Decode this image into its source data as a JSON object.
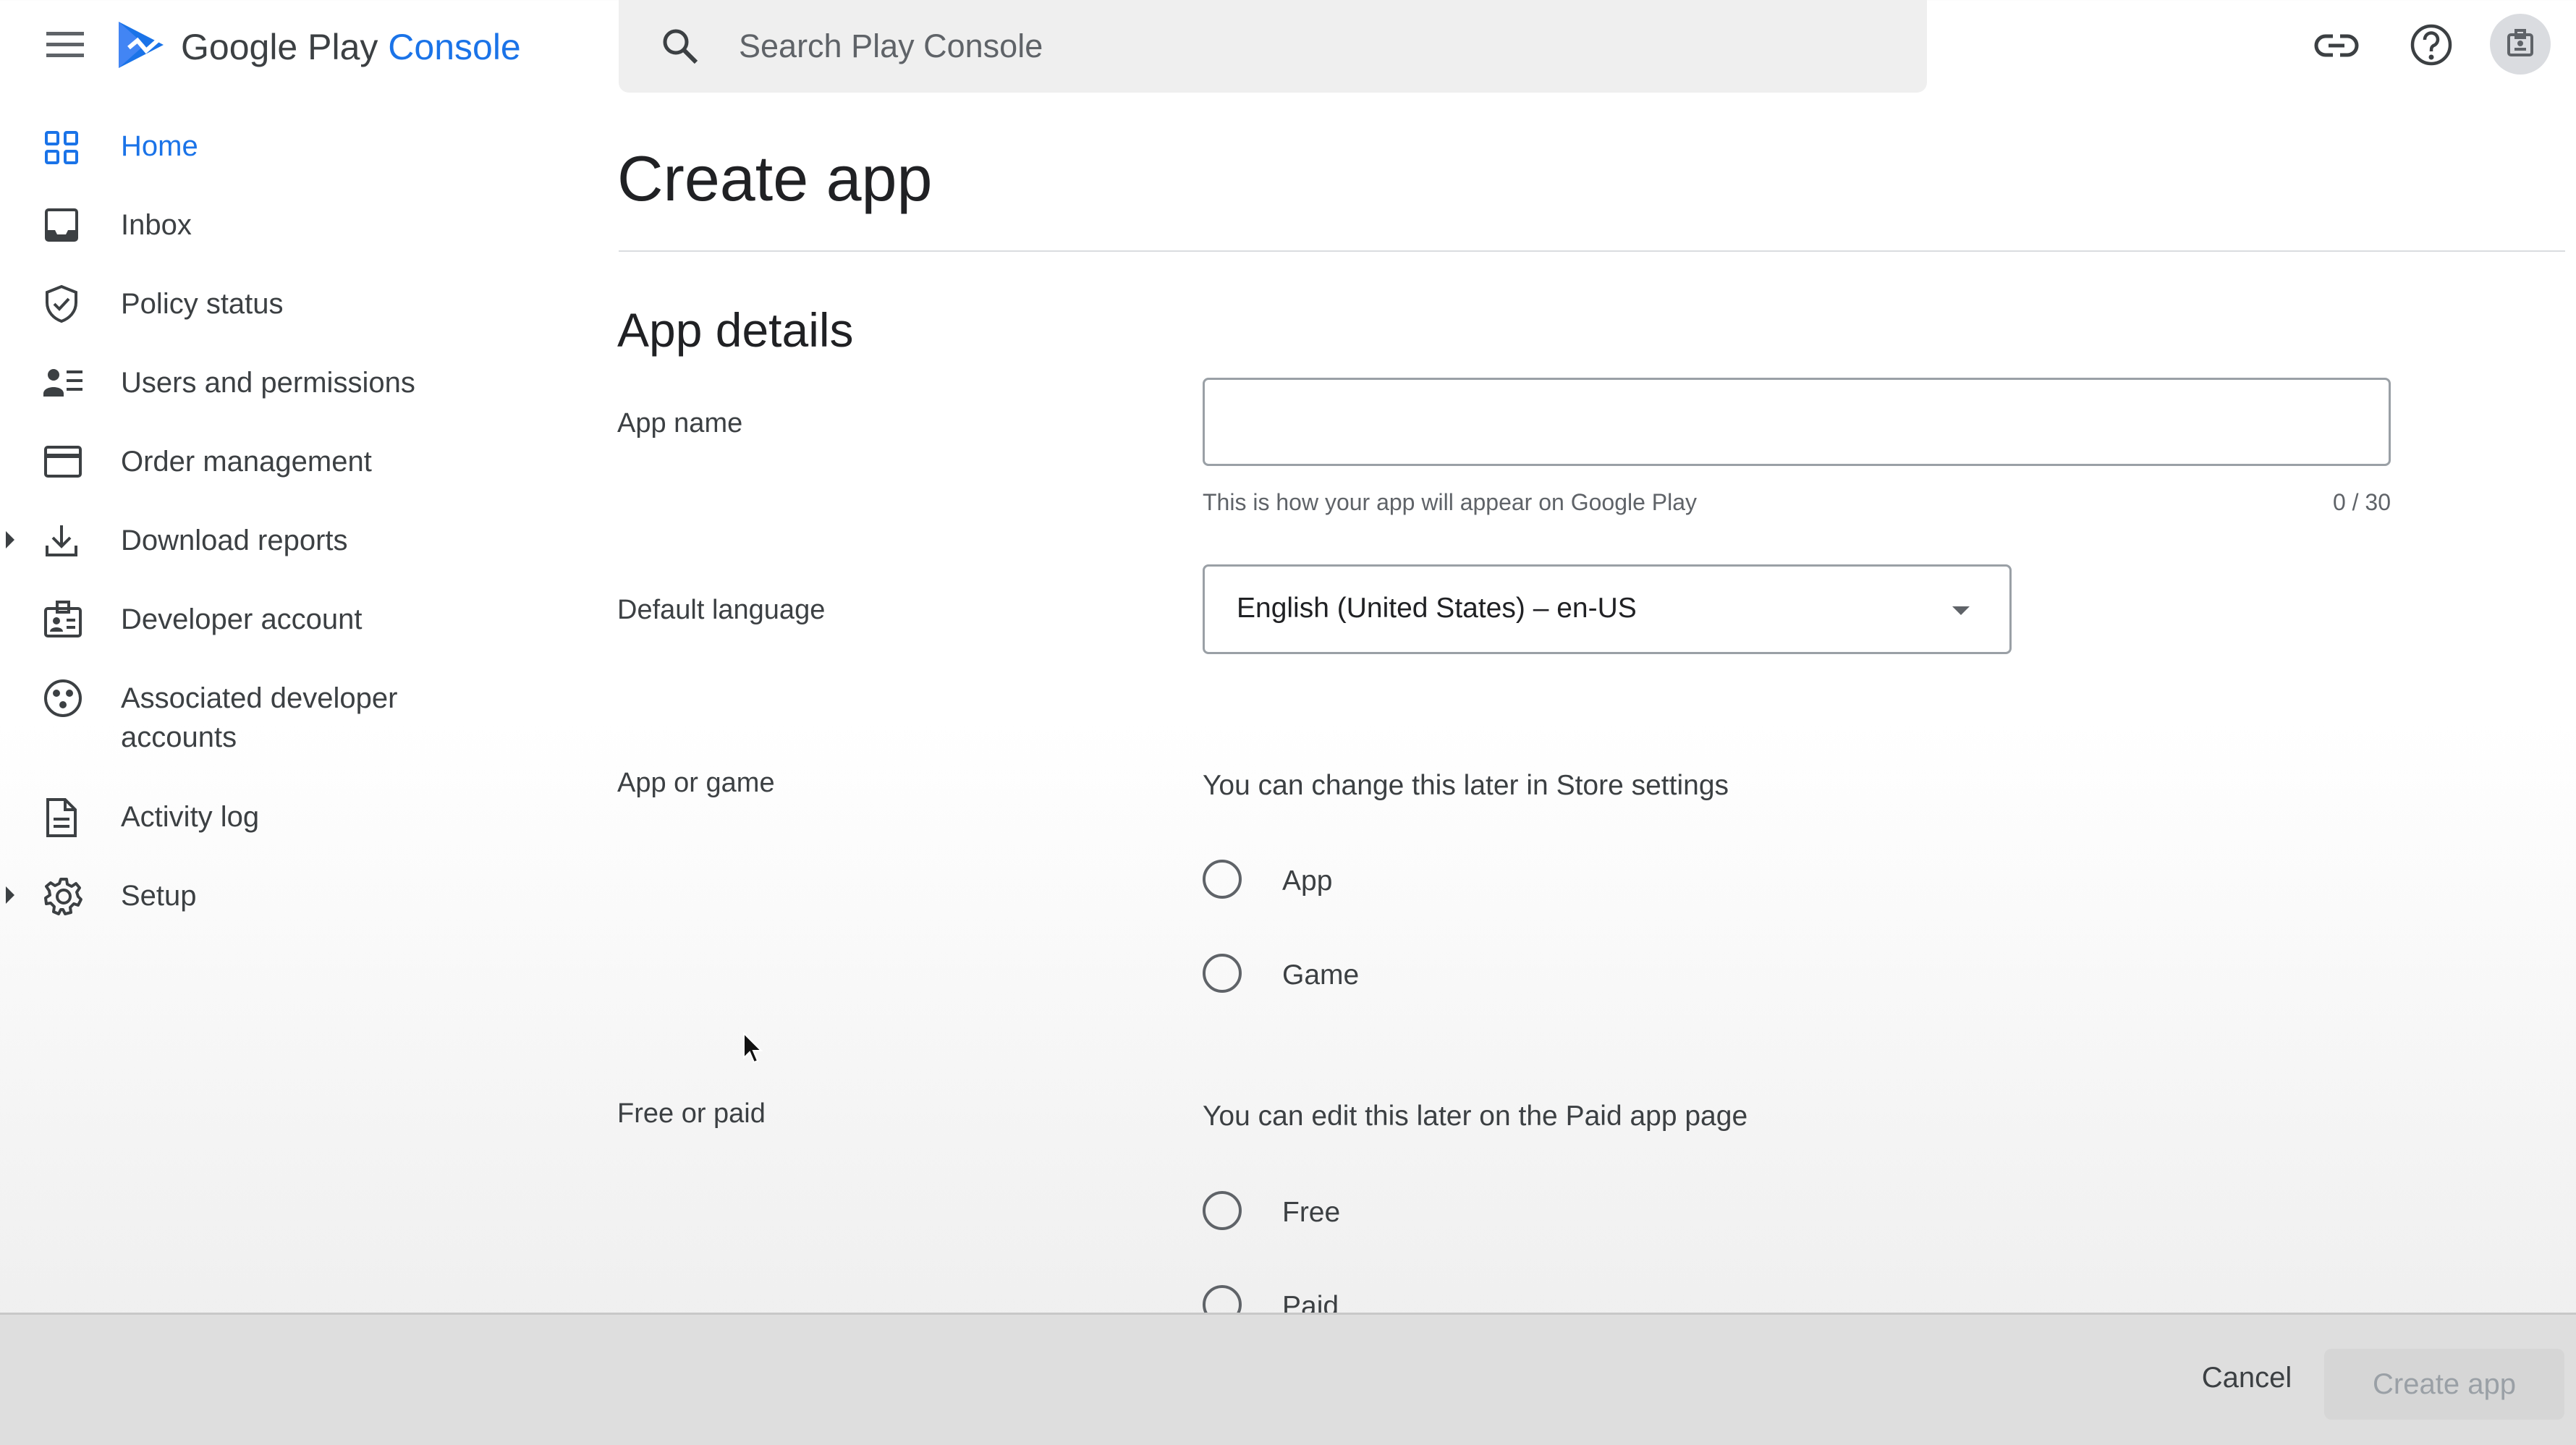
{
  "header": {
    "menu_icon": "hamburger-menu-icon",
    "logo_icon": "google-play-logo-icon",
    "logo_text_main": "Google Play",
    "logo_text_accent": "Console",
    "search_placeholder": "Search Play Console",
    "right_icons": [
      "link-icon",
      "help-icon",
      "developer-account-icon"
    ],
    "accent_color": "#1a73e8"
  },
  "sidebar": {
    "items": [
      {
        "label": "Home",
        "icon": "home-grid-icon",
        "active": true
      },
      {
        "label": "Inbox",
        "icon": "inbox-icon"
      },
      {
        "label": "Policy status",
        "icon": "policy-shield-icon"
      },
      {
        "label": "Users and permissions",
        "icon": "users-icon"
      },
      {
        "label": "Order management",
        "icon": "credit-card-icon"
      },
      {
        "label": "Download reports",
        "icon": "download-icon",
        "expandable": true
      },
      {
        "label": "Developer account",
        "icon": "developer-account-icon"
      },
      {
        "label": "Associated developer",
        "label2": "accounts",
        "icon": "associated-accounts-icon"
      },
      {
        "label": "Activity log",
        "icon": "document-icon"
      },
      {
        "label": "Setup",
        "icon": "gear-icon",
        "expandable": true
      }
    ]
  },
  "main": {
    "title": "Create app",
    "section_title": "App details",
    "app_name": {
      "label": "App name",
      "value": "",
      "helper": "This is how your app will appear on Google Play",
      "counter": "0 / 30"
    },
    "default_language": {
      "label": "Default language",
      "value": "English (United States) – en-US"
    },
    "app_or_game": {
      "label": "App or game",
      "hint": "You can change this later in Store settings",
      "options": [
        "App",
        "Game"
      ]
    },
    "free_or_paid": {
      "label": "Free or paid",
      "hint": "You can edit this later on the Paid app page",
      "options": [
        "Free",
        "Paid"
      ]
    }
  },
  "footer": {
    "cancel_label": "Cancel",
    "create_label": "Create app"
  }
}
